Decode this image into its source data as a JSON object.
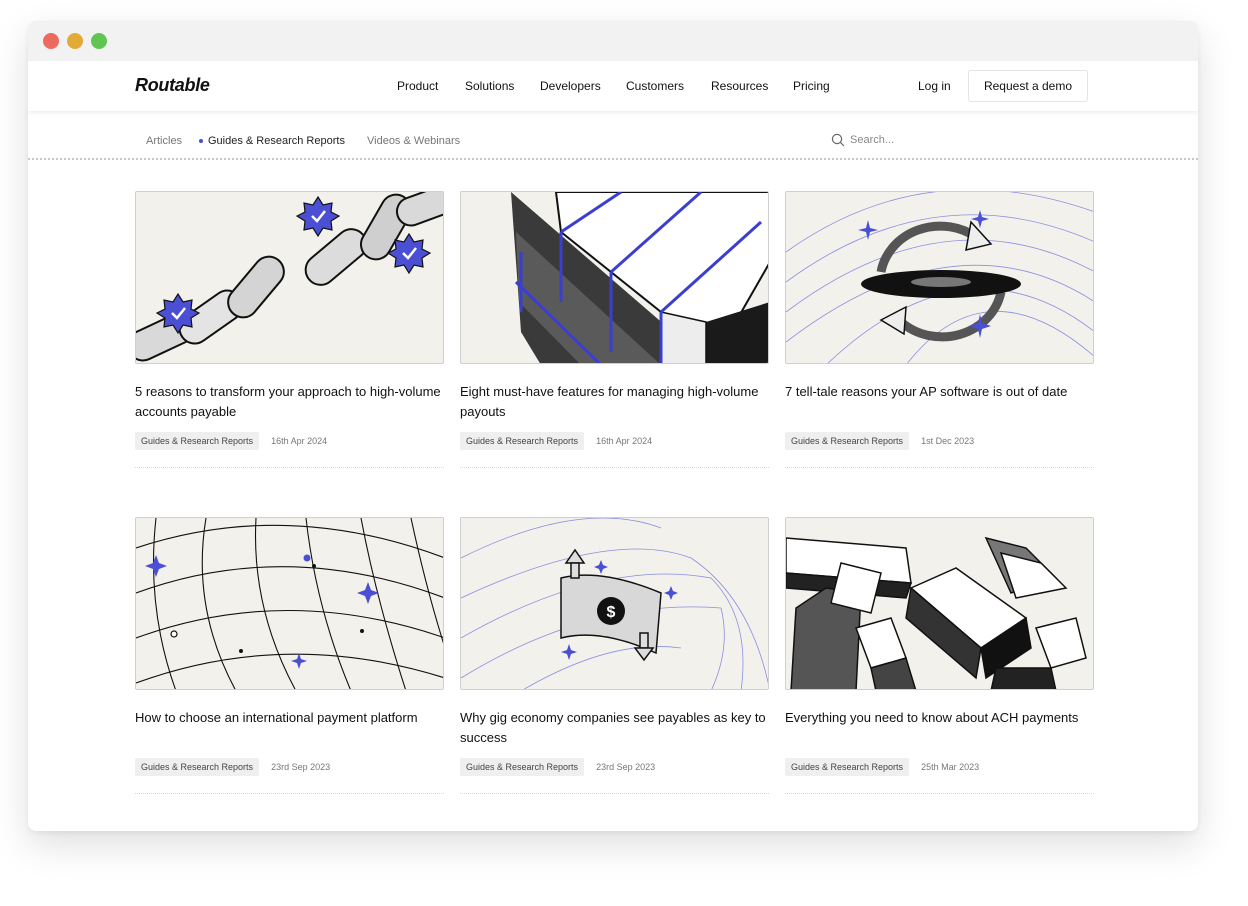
{
  "brand": {
    "name": "Routable"
  },
  "nav": {
    "items": [
      "Product",
      "Solutions",
      "Developers",
      "Customers",
      "Resources",
      "Pricing"
    ],
    "login": "Log in",
    "cta": "Request a demo"
  },
  "subnav": {
    "items": [
      "Articles",
      "Guides & Research Reports",
      "Videos & Webinars"
    ],
    "active": "Guides & Research Reports"
  },
  "search": {
    "placeholder": "Search..."
  },
  "colors": {
    "accent": "#4b4fd3",
    "illustration_bg": "#f3f1ec",
    "ink": "#111111"
  },
  "articles": [
    {
      "title": "5 reasons to transform your approach to high-volume accounts payable",
      "tag": "Guides & Research Reports",
      "date": "16th Apr 2024",
      "illustration": "chain-links-with-check-badges"
    },
    {
      "title": "Eight must-have features for managing high-volume payouts",
      "tag": "Guides & Research Reports",
      "date": "16th Apr 2024",
      "illustration": "stacked-blocks"
    },
    {
      "title": "7 tell-tale reasons your AP software is out of date",
      "tag": "Guides & Research Reports",
      "date": "1st Dec 2023",
      "illustration": "circular-refresh-arrows"
    },
    {
      "title": "How to choose an international payment platform",
      "tag": "Guides & Research Reports",
      "date": "23rd Sep 2023",
      "illustration": "globe-grid"
    },
    {
      "title": "Why gig economy companies see payables as key to success",
      "tag": "Guides & Research Reports",
      "date": "23rd Sep 2023",
      "illustration": "dollar-bill-with-arrows"
    },
    {
      "title": "Everything you need to know about ACH payments",
      "tag": "Guides & Research Reports",
      "date": "25th Mar 2023",
      "illustration": "scattered-3d-blocks"
    }
  ]
}
